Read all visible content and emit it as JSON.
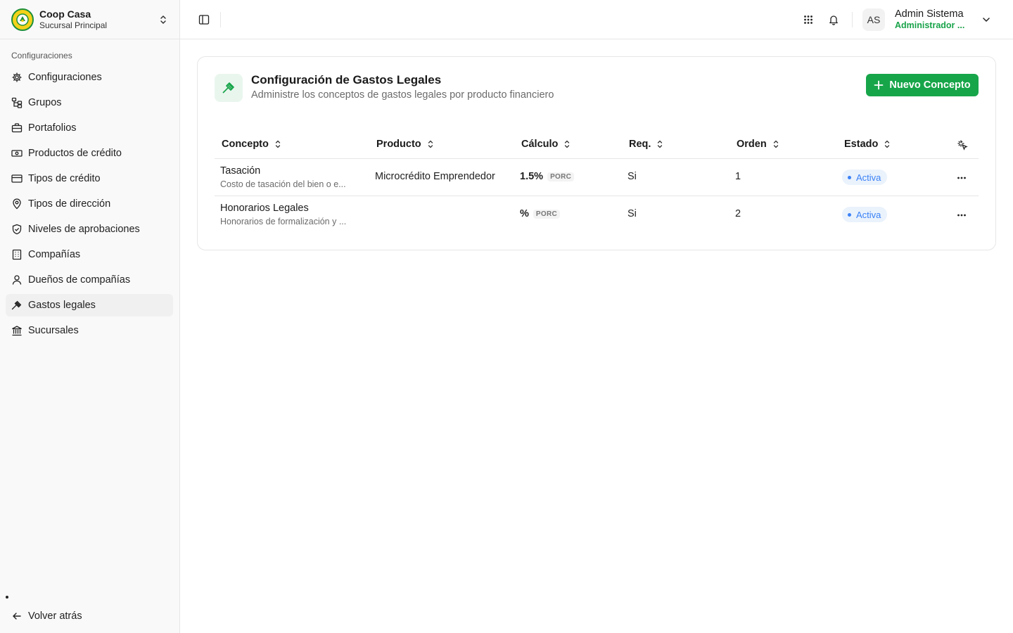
{
  "org": {
    "name": "Coop Casa",
    "branch": "Sucursal Principal"
  },
  "sidebar": {
    "group_label": "Configuraciones",
    "items": [
      {
        "label": "Configuraciones",
        "icon": "gear-icon"
      },
      {
        "label": "Grupos",
        "icon": "hierarchy-icon"
      },
      {
        "label": "Portafolios",
        "icon": "briefcase-icon"
      },
      {
        "label": "Productos de crédito",
        "icon": "banknote-icon"
      },
      {
        "label": "Tipos de crédito",
        "icon": "credit-card-icon"
      },
      {
        "label": "Tipos de dirección",
        "icon": "map-pin-icon"
      },
      {
        "label": "Niveles de aprobaciones",
        "icon": "shield-check-icon"
      },
      {
        "label": "Compañías",
        "icon": "building-icon"
      },
      {
        "label": "Dueños de compañías",
        "icon": "user-icon"
      },
      {
        "label": "Gastos legales",
        "icon": "gavel-icon",
        "active": true
      },
      {
        "label": "Sucursales",
        "icon": "bank-icon"
      }
    ],
    "back_label": "Volver atrás"
  },
  "header": {
    "user": {
      "initials": "AS",
      "name": "Admin Sistema",
      "role": "Administrador ..."
    }
  },
  "page": {
    "title": "Configuración de Gastos Legales",
    "subtitle": "Administre los conceptos de gastos legales por producto financiero",
    "new_button_label": "Nuevo Concepto"
  },
  "table": {
    "columns": {
      "concepto": "Concepto",
      "producto": "Producto",
      "calculo": "Cálculo",
      "req": "Req.",
      "orden": "Orden",
      "estado": "Estado"
    },
    "rows": [
      {
        "name": "Tasación",
        "description": "Costo de tasación del bien o e...",
        "product": "Microcrédito Emprendedor",
        "calc_value": "1.5%",
        "calc_type": "PORC",
        "required": "Si",
        "order": "1",
        "status": "Activa"
      },
      {
        "name": "Honorarios Legales",
        "description": "Honorarios de formalización y ...",
        "product": "",
        "calc_value": "%",
        "calc_type": "PORC",
        "required": "Si",
        "order": "2",
        "status": "Activa"
      }
    ]
  },
  "colors": {
    "brand_green": "#17a54a",
    "status_blue": "#3b82f6",
    "role_green": "#19a34a"
  }
}
